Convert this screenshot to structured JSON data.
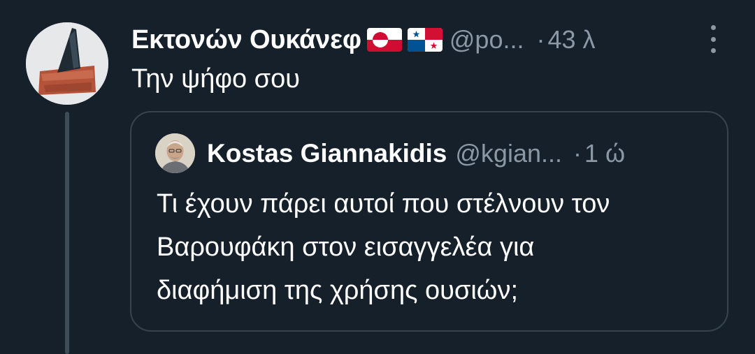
{
  "tweet": {
    "display_name": "Εκτονών Ουκάνεφ",
    "flags": [
      "greenland-flag",
      "panama-flag"
    ],
    "handle": "@po...",
    "separator": "·",
    "time": "43 λ",
    "text": "Την ψήφο σου"
  },
  "quote": {
    "display_name": "Kostas Giannakidis",
    "handle": "@kgian...",
    "separator": "·",
    "time": "1 ώ",
    "text_lines": [
      "Τι έχουν πάρει αυτοί που στέλνουν τον",
      "Βαρουφάκη στον εισαγγελέα για",
      "διαφήμιση της χρήσης ουσιών;"
    ]
  },
  "colors": {
    "background": "#15202b",
    "text_primary": "#ffffff",
    "text_secondary": "#8b98a5",
    "border": "#38444d",
    "thread_line": "#3e4c5a"
  }
}
